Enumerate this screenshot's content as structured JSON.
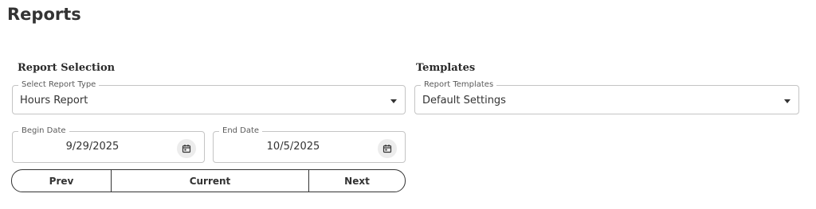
{
  "page": {
    "title": "Reports"
  },
  "report_selection": {
    "heading": "Report Selection",
    "report_type": {
      "label": "Select Report Type",
      "value": "Hours Report"
    },
    "begin_date": {
      "label": "Begin Date",
      "value": "9/29/2025"
    },
    "end_date": {
      "label": "End Date",
      "value": "10/5/2025"
    },
    "nav": {
      "prev": "Prev",
      "current": "Current",
      "next": "Next"
    }
  },
  "templates": {
    "heading": "Templates",
    "report_templates": {
      "label": "Report Templates",
      "value": "Default Settings"
    }
  },
  "icons": {
    "dropdown": "caret-down-icon",
    "date_picker": "calendar-icon"
  }
}
